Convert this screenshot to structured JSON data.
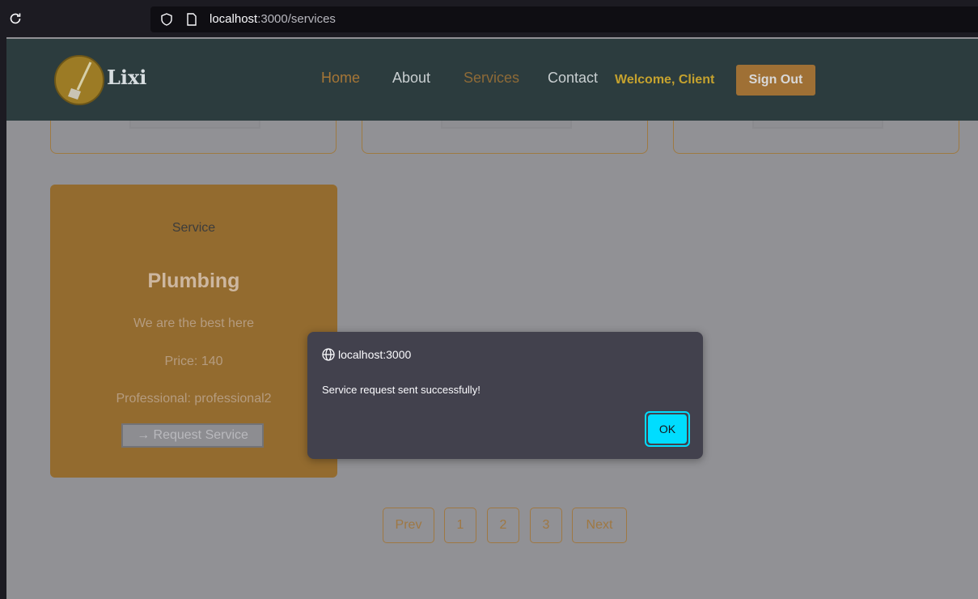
{
  "browser": {
    "url_host": "localhost",
    "url_path": ":3000/services"
  },
  "header": {
    "brand": "Lixi",
    "nav": [
      "Home",
      "About",
      "Services",
      "Contact"
    ],
    "welcome": "Welcome, Client",
    "sign_out": "Sign Out"
  },
  "card": {
    "label": "Service",
    "title": "Plumbing",
    "description": "We are the best here",
    "price": "Price: 140",
    "professional": "Professional: professional2",
    "request_button": "→ Request Service"
  },
  "pagination": {
    "prev": "Prev",
    "pages": [
      "1",
      "2",
      "3"
    ],
    "next": "Next"
  },
  "dialog": {
    "origin": "localhost:3000",
    "message": "Service request sent successfully!",
    "ok": "OK"
  },
  "colors": {
    "accent_cyan": "#00ddff",
    "brand_orange": "#a67636",
    "header_bg": "#2c3c3e"
  }
}
